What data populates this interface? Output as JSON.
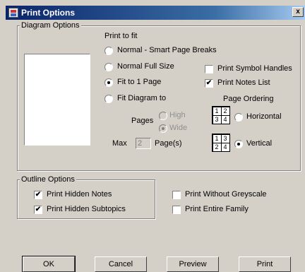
{
  "window": {
    "title": "Print Options",
    "close_glyph": "x"
  },
  "diagram_options": {
    "legend": "Diagram Options",
    "print_to_fit_label": "Print to fit",
    "options": [
      {
        "label": "Normal - Smart Page Breaks",
        "selected": false
      },
      {
        "label": "Normal Full Size",
        "selected": false
      },
      {
        "label": "Fit to 1 Page",
        "selected": true
      },
      {
        "label": "Fit Diagram to",
        "selected": false
      }
    ],
    "pages_label": "Pages",
    "pages_options": [
      {
        "label": "High",
        "selected": false,
        "enabled": false
      },
      {
        "label": "Wide",
        "selected": true,
        "enabled": false
      }
    ],
    "max_label": "Max",
    "max_value": "2",
    "pages_suffix": "Page(s)",
    "print_symbol_handles": {
      "label": "Print Symbol Handles",
      "checked": false
    },
    "print_notes_list": {
      "label": "Print Notes List",
      "checked": true
    },
    "page_ordering_label": "Page Ordering",
    "horizontal": {
      "label": "Horizontal",
      "selected": false,
      "grid": [
        "1",
        "2",
        "3",
        "4"
      ]
    },
    "vertical": {
      "label": "Vertical",
      "selected": true,
      "grid": [
        "1",
        "3",
        "2",
        "4"
      ]
    }
  },
  "outline_options": {
    "legend": "Outline Options",
    "print_hidden_notes": {
      "label": "Print Hidden Notes",
      "checked": true
    },
    "print_hidden_subtopics": {
      "label": "Print Hidden Subtopics",
      "checked": true
    }
  },
  "print_without_greyscale": {
    "label": "Print Without Greyscale",
    "checked": false
  },
  "print_entire_family": {
    "label": "Print Entire Family",
    "checked": false
  },
  "buttons": {
    "ok": "OK",
    "cancel": "Cancel",
    "preview": "Preview",
    "print": "Print"
  },
  "check_glyph": "✔"
}
